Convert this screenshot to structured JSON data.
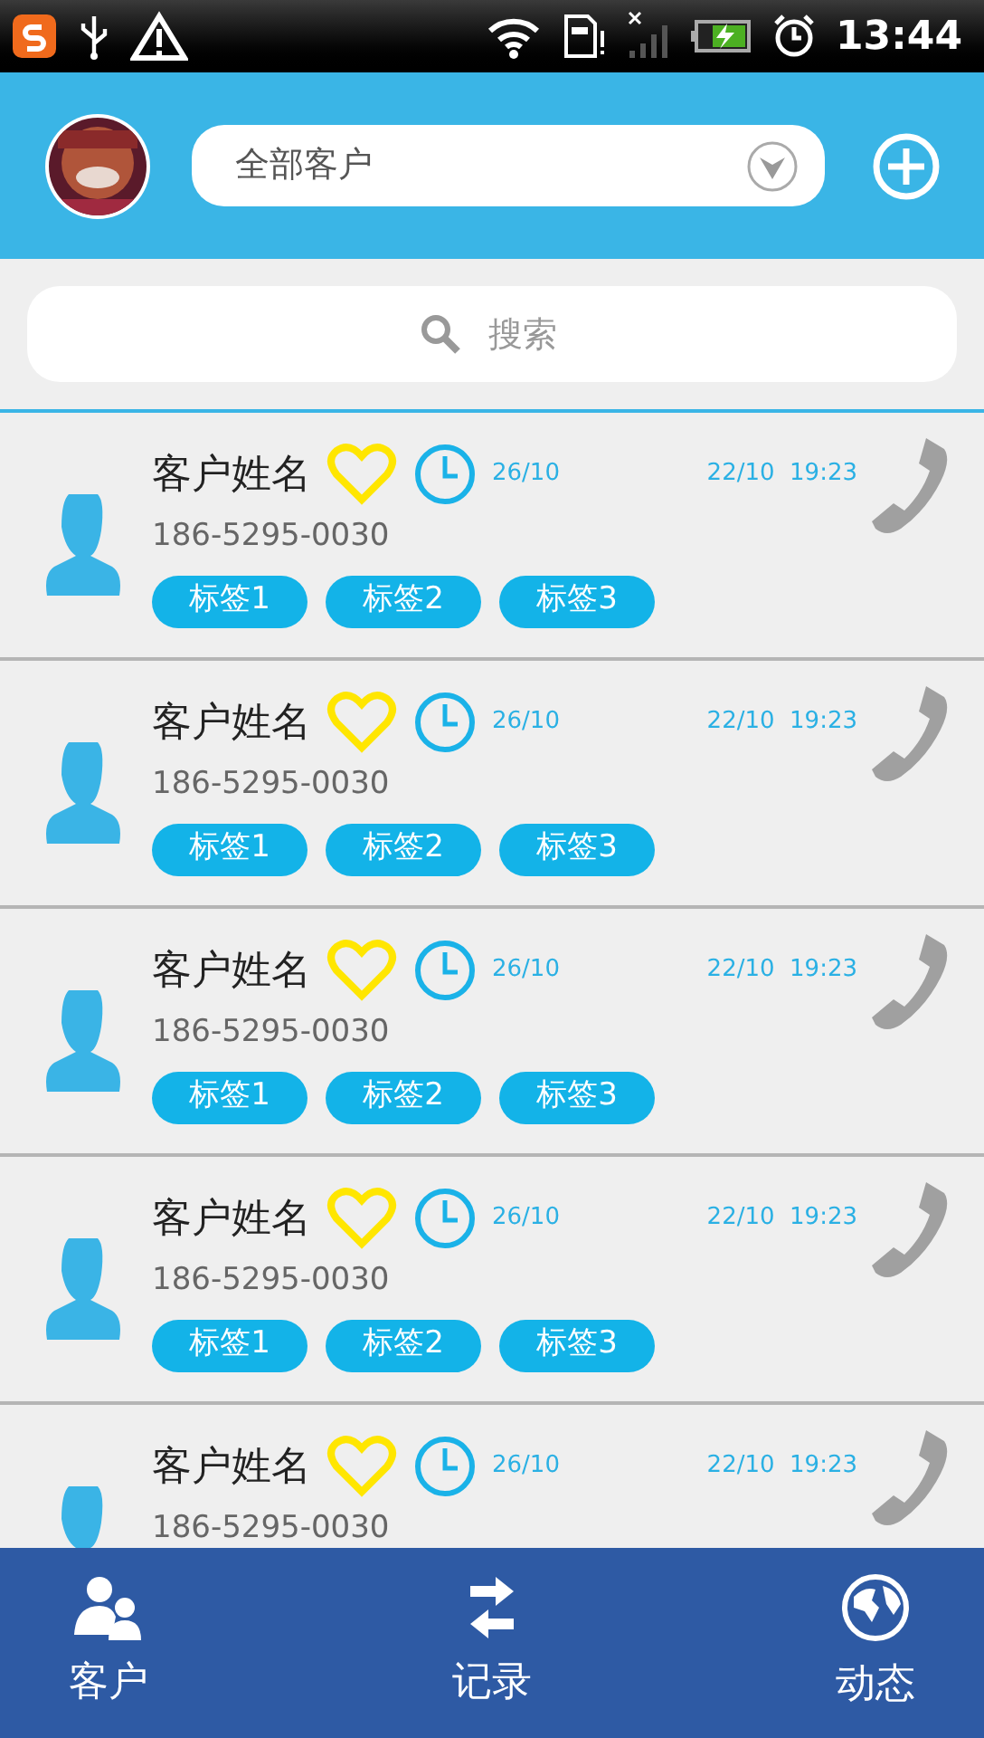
{
  "status_bar": {
    "time": "13:44"
  },
  "header": {
    "filter": "全部客户"
  },
  "search": {
    "placeholder": "搜索"
  },
  "customers": [
    {
      "name": "客户姓名",
      "phone": "186-5295-0030",
      "reminder": "26/10",
      "last_contact": "22/10  19:23",
      "tags": [
        "标签1",
        "标签2",
        "标签3"
      ]
    },
    {
      "name": "客户姓名",
      "phone": "186-5295-0030",
      "reminder": "26/10",
      "last_contact": "22/10  19:23",
      "tags": [
        "标签1",
        "标签2",
        "标签3"
      ]
    },
    {
      "name": "客户姓名",
      "phone": "186-5295-0030",
      "reminder": "26/10",
      "last_contact": "22/10  19:23",
      "tags": [
        "标签1",
        "标签2",
        "标签3"
      ]
    },
    {
      "name": "客户姓名",
      "phone": "186-5295-0030",
      "reminder": "26/10",
      "last_contact": "22/10  19:23",
      "tags": [
        "标签1",
        "标签2",
        "标签3"
      ]
    },
    {
      "name": "客户姓名",
      "phone": "186-5295-0030",
      "reminder": "26/10",
      "last_contact": "22/10  19:23"
    }
  ],
  "nav": [
    {
      "kind": "customers",
      "label": "客户"
    },
    {
      "kind": "records",
      "label": "记录"
    },
    {
      "kind": "activity",
      "label": "动态"
    }
  ]
}
